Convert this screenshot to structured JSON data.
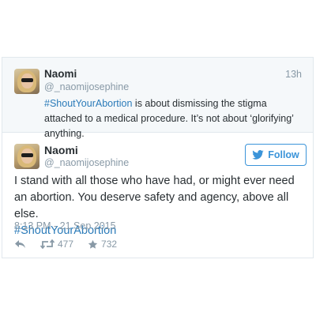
{
  "prev_tweet": {
    "name": "Naomi",
    "handle": "@_naomijosephine",
    "time": "13h",
    "hashtag": "#ShoutYourAbortion",
    "text": " is about dismissing the stigma attached to a medical procedure. It’s not about ‘glorifying’ anything."
  },
  "main_tweet": {
    "name": "Naomi",
    "handle": "@_naomijosephine",
    "follow_label": "Follow",
    "text": "I stand with all those who have had, or might ever need an abortion. You deserve safety and agency, above all else.",
    "hashtag": "#ShoutYourAbortion",
    "timestamp": "8:13 PM - 21 Sep 2015",
    "retweets": "477",
    "likes": "732"
  },
  "colors": {
    "link": "#2b7bb9",
    "follow_blue": "#3b94d9",
    "muted": "#8899a6",
    "text": "#292f33"
  },
  "icons": [
    "twitter-bird-icon",
    "reply-icon",
    "retweet-icon",
    "star-icon"
  ]
}
